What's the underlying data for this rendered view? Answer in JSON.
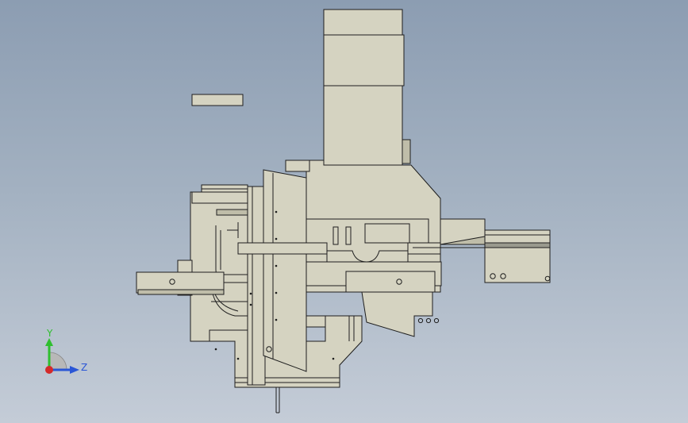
{
  "viewport": {
    "background_top": "#8c9db2",
    "background_bottom": "#c4ccd7",
    "part_fill": "#d5d3c1",
    "part_shade": "#bfbda9",
    "line_color": "#1e1e1e"
  },
  "triad": {
    "y_label": "Y",
    "z_label": "Z",
    "y_color": "#2fbf2f",
    "z_color": "#2a56d6",
    "x_color": "#d42a2a"
  }
}
